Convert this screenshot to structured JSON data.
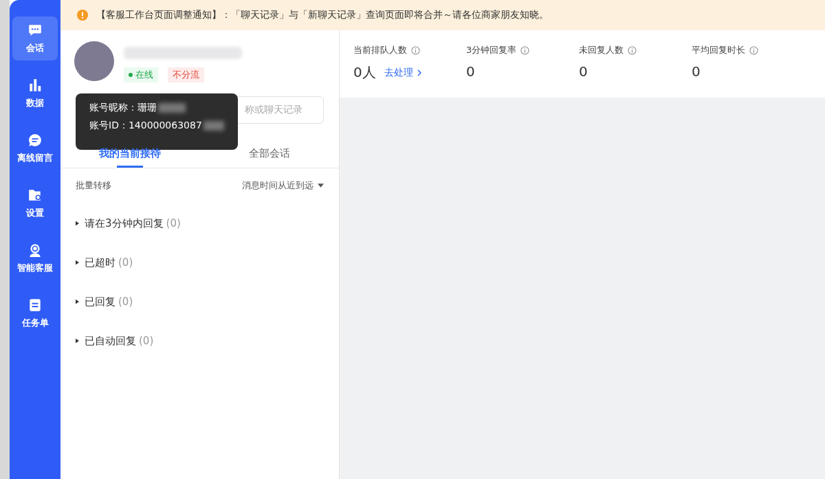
{
  "notice": {
    "text": "【客服工作台页面调整通知】：「聊天记录」与「新聊天记录」查询页面即将合并～请各位商家朋友知晓。"
  },
  "sidebar": {
    "items": [
      {
        "label": "会话",
        "selected": true
      },
      {
        "label": "数据",
        "selected": false
      },
      {
        "label": "离线留言",
        "selected": false
      },
      {
        "label": "设置",
        "selected": false
      },
      {
        "label": "智能客服",
        "selected": false
      },
      {
        "label": "任务单",
        "selected": false
      }
    ]
  },
  "profile": {
    "badges": [
      {
        "label": "在线",
        "kind": "online"
      },
      {
        "label": "不分流",
        "kind": "warning"
      }
    ]
  },
  "tooltip": {
    "lines": [
      "账号昵称：珊珊",
      "账号ID：140000063087"
    ]
  },
  "search": {
    "placeholder": "称或聊天记录"
  },
  "tabs": [
    {
      "label": "我的当前接待",
      "selected": true
    },
    {
      "label": "全部会话",
      "selected": false
    }
  ],
  "toolbar": {
    "batch": "批量转移",
    "sort": "消息时间从近到远"
  },
  "groups": [
    {
      "label": "请在3分钟内回复",
      "count": "(0)",
      "expanded": false
    },
    {
      "label": "已超时",
      "count": "(0)",
      "expanded": false
    },
    {
      "label": "已回复",
      "count": "(0)",
      "expanded": false
    },
    {
      "label": "已自动回复",
      "count": "(0)",
      "expanded": false
    }
  ],
  "stats": [
    {
      "label": "当前排队人数",
      "value": "0人",
      "link": "去处理"
    },
    {
      "label": "3分钟回复率",
      "value": "0"
    },
    {
      "label": "未回复人数",
      "value": "0"
    },
    {
      "label": "平均回复时长",
      "value": "0"
    }
  ]
}
